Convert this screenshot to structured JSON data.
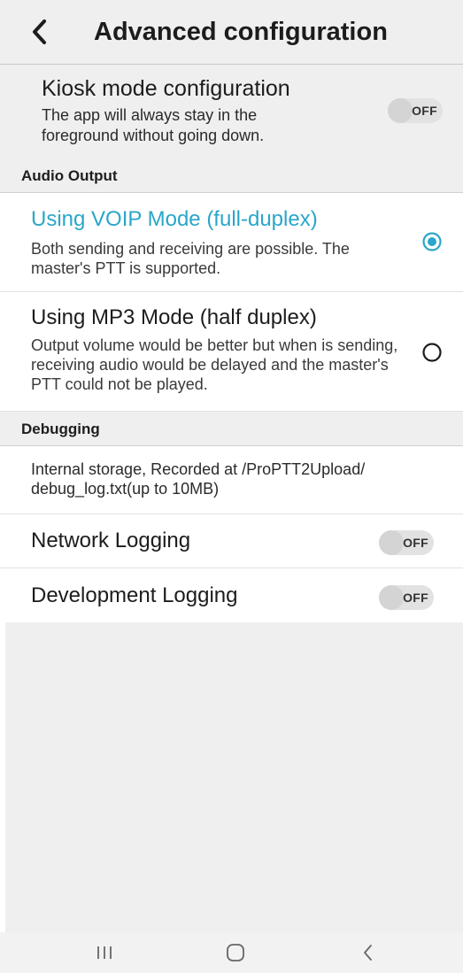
{
  "header": {
    "title": "Advanced configuration"
  },
  "kiosk": {
    "title": "Kiosk mode configuration",
    "description": "The app will always stay in the foreground without going down.",
    "toggle_label": "OFF"
  },
  "audio_output": {
    "section_label": "Audio Output",
    "options": [
      {
        "title": "Using VOIP Mode (full-duplex)",
        "description": "Both sending and receiving are possible. The master's PTT is supported.",
        "selected": true
      },
      {
        "title": "Using MP3 Mode (half duplex)",
        "description": "Output volume would be better but when is sending, receiving audio would be delayed and the master's PTT could not be played.",
        "selected": false
      }
    ]
  },
  "debugging": {
    "section_label": "Debugging",
    "storage_info": "Internal storage, Recorded at /ProPTT2Upload/ debug_log.txt(up to 10MB)",
    "network_logging": {
      "label": "Network Logging",
      "toggle_label": "OFF"
    },
    "development_logging": {
      "label": "Development Logging",
      "toggle_label": "OFF"
    }
  },
  "colors": {
    "accent": "#2aa6c8",
    "header_background": "#efefef",
    "toggle_off": "#e2e2e2"
  },
  "icons": {
    "back": "chevron-left-icon",
    "radio_selected": "radio-selected-icon",
    "radio_unselected": "radio-unselected-icon",
    "nav_recents": "recent-apps-icon",
    "nav_home": "home-icon",
    "nav_back": "back-icon"
  }
}
